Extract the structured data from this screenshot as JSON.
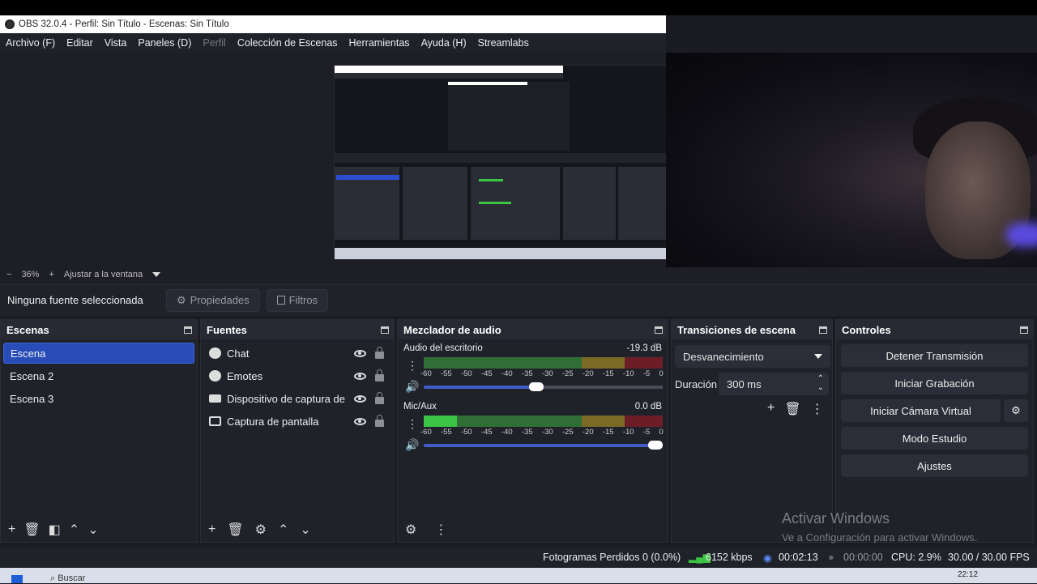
{
  "window": {
    "title": "OBS 32.0.4 - Perfil: Sin Título - Escenas: Sin Título"
  },
  "menu": [
    {
      "label": "Archivo (F)"
    },
    {
      "label": "Editar"
    },
    {
      "label": "Vista"
    },
    {
      "label": "Paneles (D)"
    },
    {
      "label": "Perfil",
      "disabled": true
    },
    {
      "label": "Colección de Escenas"
    },
    {
      "label": "Herramientas"
    },
    {
      "label": "Ayuda (H)"
    },
    {
      "label": "Streamlabs"
    }
  ],
  "zoom": {
    "minus": "−",
    "value": "36%",
    "plus": "+",
    "fit": "Ajustar a la ventana"
  },
  "source_toolbar": {
    "no_selection": "Ninguna fuente seleccionada",
    "properties": "Propiedades",
    "filters": "Filtros"
  },
  "scenes": {
    "title": "Escenas",
    "items": [
      {
        "label": "Escena",
        "active": true
      },
      {
        "label": "Escena 2"
      },
      {
        "label": "Escena 3"
      }
    ]
  },
  "sources": {
    "title": "Fuentes",
    "items": [
      {
        "label": "Chat",
        "icon": "browser-icon"
      },
      {
        "label": "Emotes",
        "icon": "browser-icon"
      },
      {
        "label": "Dispositivo de captura de vídeo",
        "icon": "camera-icon"
      },
      {
        "label": "Captura de pantalla",
        "icon": "monitor-icon"
      }
    ]
  },
  "mixer": {
    "title": "Mezclador de audio",
    "ticks": [
      "-60",
      "-55",
      "-50",
      "-45",
      "-40",
      "-35",
      "-30",
      "-25",
      "-20",
      "-15",
      "-10",
      "-5",
      "0"
    ],
    "tracks": [
      {
        "name": "Audio del escritorio",
        "db": "-19.3 dB",
        "volume": 0.47,
        "level": 0.0
      },
      {
        "name": "Mic/Aux",
        "db": "0.0 dB",
        "volume": 1.0,
        "level": 0.14
      }
    ]
  },
  "transitions": {
    "title": "Transiciones de escena",
    "selected": "Desvanecimiento",
    "duration_label": "Duración",
    "duration_value": "300 ms"
  },
  "controls": {
    "title": "Controles",
    "buttons": [
      "Detener Transmisión",
      "Iniciar Grabación",
      "Iniciar Cámara Virtual",
      "Modo Estudio",
      "Ajustes"
    ]
  },
  "status": {
    "dropped": "Fotogramas Perdidos 0 (0.0%)",
    "bitrate": "6152 kbps",
    "stream_time": "00:02:13",
    "rec_time": "00:00:00",
    "cpu": "CPU: 2.9%",
    "fps": "30.00 / 30.00 FPS"
  },
  "watermark": {
    "line1": "Activar Windows",
    "line2": "Ve a Configuración para activar Windows."
  },
  "taskbar": {
    "search": "Buscar",
    "clock": "22:12"
  },
  "colors": {
    "accent": "#284cb8",
    "meter_green": "#3cc444",
    "panel": "#20222a"
  }
}
